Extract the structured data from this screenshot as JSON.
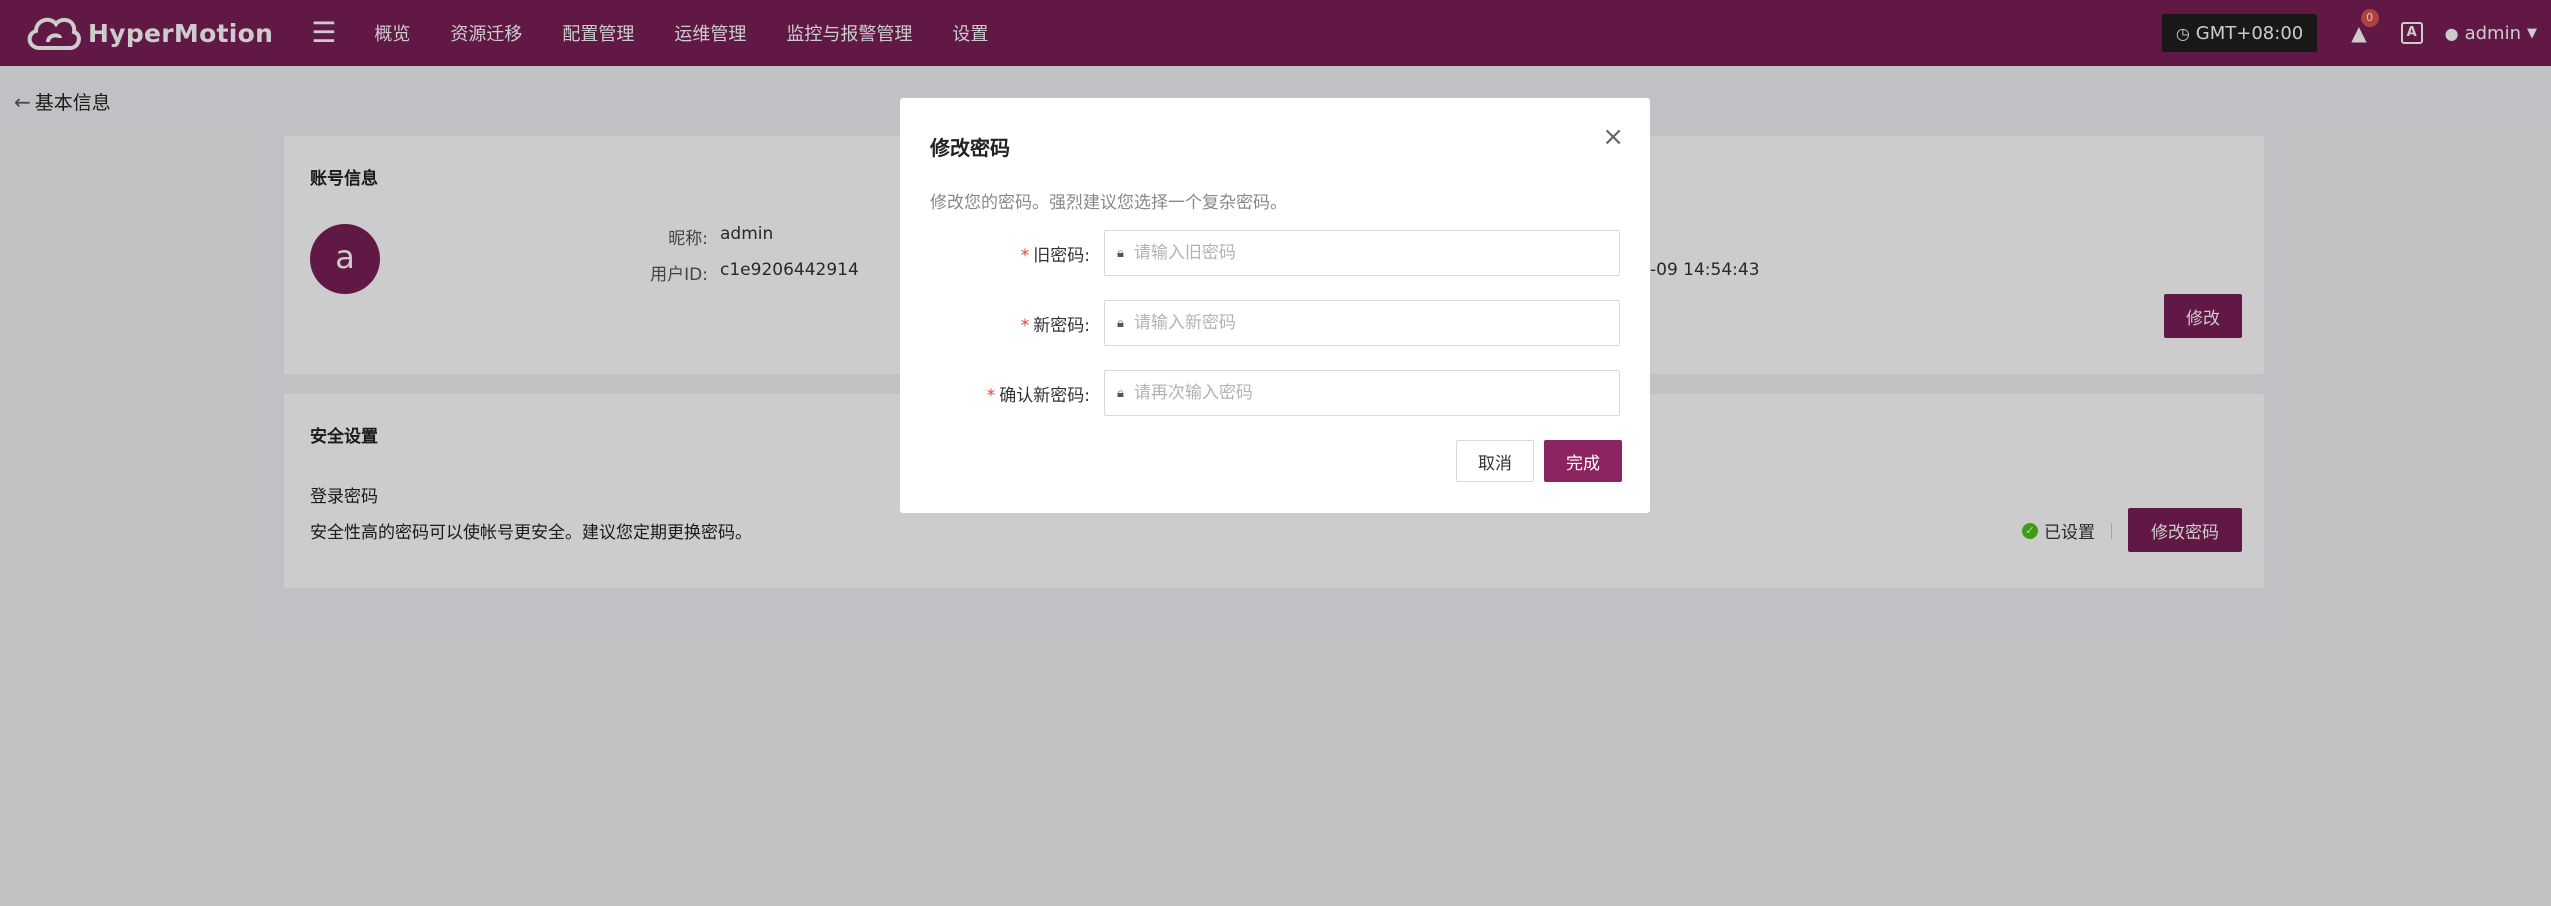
{
  "app": {
    "brand": "HyperMotion",
    "brand_color": "#7a1f57"
  },
  "nav": {
    "menu_icon": "hamburger-icon",
    "items": [
      {
        "label": "概览"
      },
      {
        "label": "资源迁移"
      },
      {
        "label": "配置管理"
      },
      {
        "label": "运维管理"
      },
      {
        "label": "监控与报警管理"
      },
      {
        "label": "设置"
      }
    ]
  },
  "header_right": {
    "timezone": "GMT+08:00",
    "alert_count": "0",
    "lang_icon_text": "A",
    "username": "admin"
  },
  "page": {
    "title": "基本信息"
  },
  "account": {
    "title": "账号信息",
    "avatar_letter": "a",
    "nickname_label": "昵称:",
    "nickname": "admin",
    "userid_label": "用户ID:",
    "userid": "c1e9206442914",
    "time_fragment": "-09 14:54:43",
    "edit_button": "修改"
  },
  "security": {
    "title": "安全设置",
    "password_label": "登录密码",
    "password_desc": "安全性高的密码可以使帐号更安全。建议您定期更换密码。",
    "status": "已设置",
    "status_color": "#52c41a",
    "change_button": "修改密码"
  },
  "modal": {
    "title": "修改密码",
    "description": "修改您的密码。强烈建议您选择一个复杂密码。",
    "fields": [
      {
        "label": "旧密码:",
        "placeholder": "请输入旧密码",
        "value": ""
      },
      {
        "label": "新密码:",
        "placeholder": "请输入新密码",
        "value": ""
      },
      {
        "label": "确认新密码:",
        "placeholder": "请再次输入密码",
        "value": ""
      }
    ],
    "required_mark": "*",
    "cancel_button": "取消",
    "confirm_button": "完成"
  }
}
